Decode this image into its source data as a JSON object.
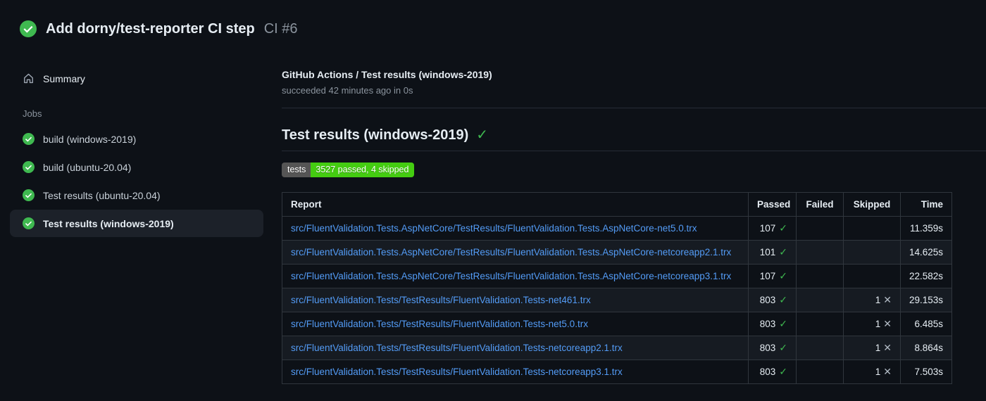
{
  "header": {
    "title": "Add dorny/test-reporter CI step",
    "run_number": "CI #6"
  },
  "sidebar": {
    "summary_label": "Summary",
    "jobs_label": "Jobs",
    "jobs": [
      {
        "label": "build (windows-2019)",
        "selected": false
      },
      {
        "label": "build (ubuntu-20.04)",
        "selected": false
      },
      {
        "label": "Test results (ubuntu-20.04)",
        "selected": false
      },
      {
        "label": "Test results (windows-2019)",
        "selected": true
      }
    ]
  },
  "main": {
    "breadcrumb": "GitHub Actions / Test results (windows-2019)",
    "status_line": "succeeded 42 minutes ago in 0s",
    "heading": "Test results (windows-2019)",
    "badge": {
      "label": "tests",
      "value": "3527 passed, 4 skipped"
    },
    "table": {
      "headers": [
        "Report",
        "Passed",
        "Failed",
        "Skipped",
        "Time"
      ],
      "rows": [
        {
          "report": "src/FluentValidation.Tests.AspNetCore/TestResults/FluentValidation.Tests.AspNetCore-net5.0.trx",
          "passed": "107",
          "failed": "",
          "skipped": "",
          "time": "11.359s"
        },
        {
          "report": "src/FluentValidation.Tests.AspNetCore/TestResults/FluentValidation.Tests.AspNetCore-netcoreapp2.1.trx",
          "passed": "101",
          "failed": "",
          "skipped": "",
          "time": "14.625s"
        },
        {
          "report": "src/FluentValidation.Tests.AspNetCore/TestResults/FluentValidation.Tests.AspNetCore-netcoreapp3.1.trx",
          "passed": "107",
          "failed": "",
          "skipped": "",
          "time": "22.582s"
        },
        {
          "report": "src/FluentValidation.Tests/TestResults/FluentValidation.Tests-net461.trx",
          "passed": "803",
          "failed": "",
          "skipped": "1",
          "time": "29.153s"
        },
        {
          "report": "src/FluentValidation.Tests/TestResults/FluentValidation.Tests-net5.0.trx",
          "passed": "803",
          "failed": "",
          "skipped": "1",
          "time": "6.485s"
        },
        {
          "report": "src/FluentValidation.Tests/TestResults/FluentValidation.Tests-netcoreapp2.1.trx",
          "passed": "803",
          "failed": "",
          "skipped": "1",
          "time": "8.864s"
        },
        {
          "report": "src/FluentValidation.Tests/TestResults/FluentValidation.Tests-netcoreapp3.1.trx",
          "passed": "803",
          "failed": "",
          "skipped": "1",
          "time": "7.503s"
        }
      ]
    }
  },
  "icons": {
    "run_status": "check-circle-icon",
    "summary": "home-icon",
    "job_status": "check-circle-icon",
    "heading_check_glyph": "✓",
    "passed_check_glyph": "✓",
    "skipped_cross_glyph": "✕"
  },
  "colors": {
    "background": "#0d1117",
    "text_primary": "#e6edf3",
    "text_secondary": "#8b949e",
    "link": "#539bf5",
    "green": "#3fb950",
    "badge_label_bg": "#555555",
    "badge_value_bg": "#44cc11",
    "table_border": "#30363d",
    "row_alt_bg": "#161b22",
    "selected_item_bg": "#1c2129"
  }
}
